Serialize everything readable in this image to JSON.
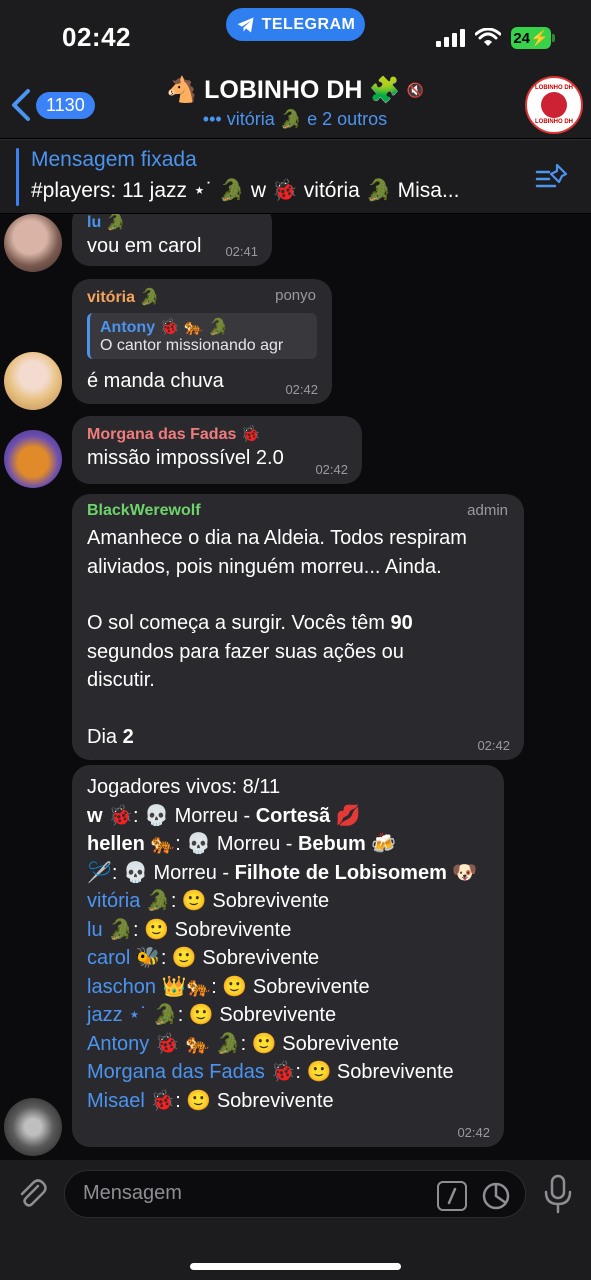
{
  "status": {
    "time": "02:42",
    "app_pill": "TELEGRAM",
    "battery": "24"
  },
  "header": {
    "back_count": "1130",
    "title": "🐴 LOBINHO DH 🧩",
    "subtitle": "••• vitória 🐊 e 2 outros",
    "channel_avatar_text_top": "LOBINHO DH",
    "channel_avatar_text_bottom": "LOBINHO DH"
  },
  "pinned": {
    "title": "Mensagem fixada",
    "text": "#players: 11 jazz ⋆˙ 🐊     w 🐞 vitória 🐊 Misa..."
  },
  "messages": {
    "m1": {
      "name": "lu 🐊",
      "text": "vou em carol",
      "time": "02:41"
    },
    "m2": {
      "name": "vitória 🐊",
      "role": "ponyo",
      "reply_name": "Antony 🐞 🐅 🐊",
      "reply_text": "O cantor missionando agr",
      "text": "é manda chuva",
      "time": "02:42"
    },
    "m3": {
      "name": "Morgana das Fadas 🐞",
      "text": "missão impossível 2.0",
      "time": "02:42"
    },
    "m4": {
      "name": "BlackWerewolf",
      "role": "admin",
      "line1": "Amanhece o dia na Aldeia. Todos respiram",
      "line2": "aliviados, pois ninguém morreu... Ainda.",
      "line3a": "O sol começa a surgir. Vocês têm ",
      "line3b": "90",
      "line4": "segundos para fazer suas ações ou",
      "line5": "discutir.",
      "day_label": "Dia ",
      "day_value": "2",
      "time": "02:42"
    },
    "m5": {
      "header": "Jogadores vivos: 8/11",
      "dead": [
        {
          "player": "w 🐞",
          "status": ": 💀 Morreu - ",
          "role": "Cortesã 💋"
        },
        {
          "player": "hellen 🐅",
          "status": ": 💀 Morreu - ",
          "role": "Bebum 🍻"
        },
        {
          "player": "🪡",
          "status": ": 💀 Morreu - ",
          "role": "Filhote de Lobisomem 🐶"
        }
      ],
      "alive": [
        {
          "player": "vitória 🐊",
          "status": ": 🙂 Sobrevivente"
        },
        {
          "player": "lu 🐊",
          "status": ": 🙂 Sobrevivente"
        },
        {
          "player": "carol 🐝",
          "status": ": 🙂 Sobrevivente"
        },
        {
          "player": "laschon 👑🐅",
          "status": ": 🙂 Sobrevivente"
        },
        {
          "player": "jazz ⋆˙ 🐊",
          "status": ": 🙂 Sobrevivente"
        },
        {
          "player": "Antony 🐞 🐅 🐊",
          "status": ": 🙂 Sobrevivente"
        },
        {
          "player": "Morgana das Fadas 🐞",
          "status": ": 🙂 Sobrevivente"
        },
        {
          "player": "Misael 🐞",
          "status": ": 🙂 Sobrevivente"
        }
      ],
      "time": "02:42"
    }
  },
  "composer": {
    "placeholder": "Mensagem"
  },
  "colors": {
    "accent": "#4b94f0",
    "name_vitoria": "#f5a35b",
    "name_morgana": "#f07c7c",
    "name_blackwerewolf": "#6fd36b"
  }
}
